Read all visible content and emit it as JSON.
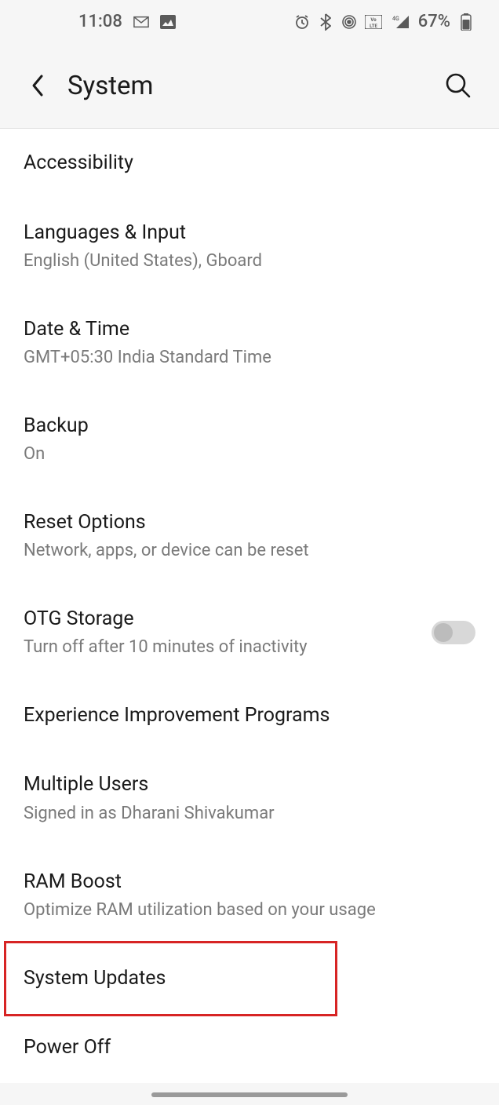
{
  "statusbar": {
    "time": "11:08",
    "battery": "67%"
  },
  "header": {
    "title": "System"
  },
  "items": [
    {
      "title": "Accessibility",
      "sub": null,
      "toggle": false
    },
    {
      "title": "Languages & Input",
      "sub": "English (United States), Gboard",
      "toggle": false
    },
    {
      "title": "Date & Time",
      "sub": "GMT+05:30 India Standard Time",
      "toggle": false
    },
    {
      "title": "Backup",
      "sub": "On",
      "toggle": false
    },
    {
      "title": "Reset Options",
      "sub": "Network, apps, or device can be reset",
      "toggle": false
    },
    {
      "title": "OTG Storage",
      "sub": "Turn off after 10 minutes of inactivity",
      "toggle": true
    },
    {
      "title": "Experience Improvement Programs",
      "sub": null,
      "toggle": false
    },
    {
      "title": "Multiple Users",
      "sub": "Signed in as Dharani Shivakumar",
      "toggle": false
    },
    {
      "title": "RAM Boost",
      "sub": "Optimize RAM utilization based on your usage",
      "toggle": false
    },
    {
      "title": "System Updates",
      "sub": null,
      "toggle": false
    },
    {
      "title": "Power Off",
      "sub": null,
      "toggle": false
    }
  ],
  "highlight": {
    "index": 9
  }
}
